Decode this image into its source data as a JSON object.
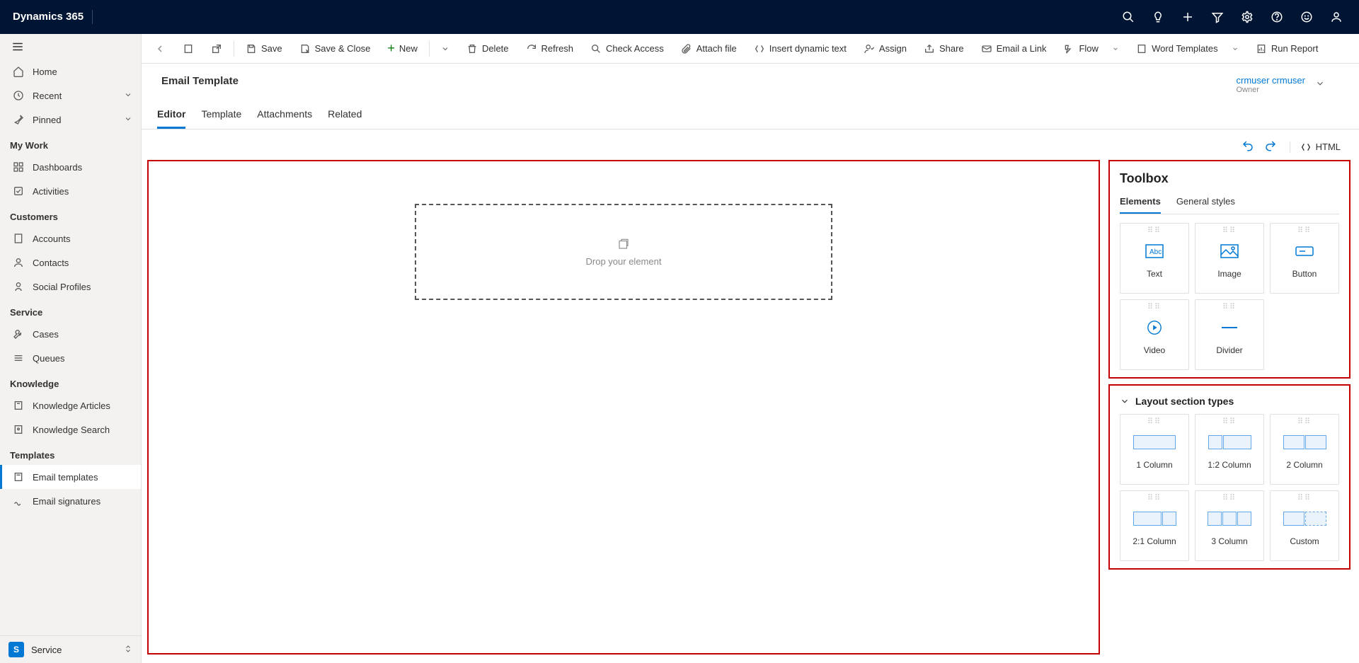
{
  "topbar": {
    "title": "Dynamics 365"
  },
  "sidebar": {
    "nav_top": [
      {
        "name": "home",
        "label": "Home"
      },
      {
        "name": "recent",
        "label": "Recent",
        "chevron": true
      },
      {
        "name": "pinned",
        "label": "Pinned",
        "chevron": true
      }
    ],
    "groups": [
      {
        "title": "My Work",
        "items": [
          {
            "name": "dashboards",
            "label": "Dashboards"
          },
          {
            "name": "activities",
            "label": "Activities"
          }
        ]
      },
      {
        "title": "Customers",
        "items": [
          {
            "name": "accounts",
            "label": "Accounts"
          },
          {
            "name": "contacts",
            "label": "Contacts"
          },
          {
            "name": "social-profiles",
            "label": "Social Profiles"
          }
        ]
      },
      {
        "title": "Service",
        "items": [
          {
            "name": "cases",
            "label": "Cases"
          },
          {
            "name": "queues",
            "label": "Queues"
          }
        ]
      },
      {
        "title": "Knowledge",
        "items": [
          {
            "name": "knowledge-articles",
            "label": "Knowledge Articles"
          },
          {
            "name": "knowledge-search",
            "label": "Knowledge Search"
          }
        ]
      },
      {
        "title": "Templates",
        "items": [
          {
            "name": "email-templates",
            "label": "Email templates",
            "selected": true
          },
          {
            "name": "email-signatures",
            "label": "Email signatures"
          }
        ]
      }
    ],
    "footer": {
      "badge": "S",
      "label": "Service"
    }
  },
  "cmdbar": {
    "save": "Save",
    "save_close": "Save & Close",
    "new": "New",
    "delete": "Delete",
    "refresh": "Refresh",
    "check_access": "Check Access",
    "attach_file": "Attach file",
    "insert_dynamic": "Insert dynamic text",
    "assign": "Assign",
    "share": "Share",
    "email_link": "Email a Link",
    "flow": "Flow",
    "word_templates": "Word Templates",
    "run_report": "Run Report"
  },
  "record": {
    "title": "Email Template",
    "owner_name": "crmuser crmuser",
    "owner_label": "Owner"
  },
  "tabs": [
    "Editor",
    "Template",
    "Attachments",
    "Related"
  ],
  "editor": {
    "html_button": "HTML",
    "drop_hint": "Drop your element"
  },
  "toolbox": {
    "title": "Toolbox",
    "tabs": [
      "Elements",
      "General styles"
    ],
    "elements": [
      {
        "name": "text",
        "label": "Text"
      },
      {
        "name": "image",
        "label": "Image"
      },
      {
        "name": "button",
        "label": "Button"
      },
      {
        "name": "video",
        "label": "Video"
      },
      {
        "name": "divider",
        "label": "Divider"
      }
    ],
    "layout_title": "Layout section types",
    "layouts": [
      {
        "name": "1-column",
        "label": "1 Column"
      },
      {
        "name": "1-2-column",
        "label": "1:2 Column"
      },
      {
        "name": "2-column",
        "label": "2 Column"
      },
      {
        "name": "2-1-column",
        "label": "2:1 Column"
      },
      {
        "name": "3-column",
        "label": "3 Column"
      },
      {
        "name": "custom",
        "label": "Custom"
      }
    ]
  }
}
